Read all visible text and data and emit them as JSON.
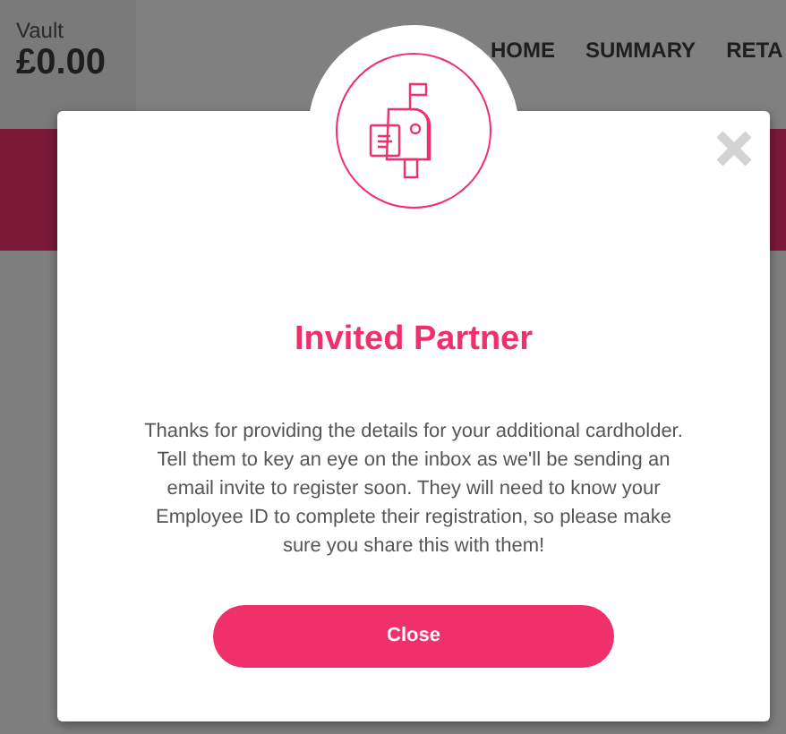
{
  "header": {
    "vault_label": "Vault",
    "vault_balance": "£0.00",
    "nav": [
      "HOME",
      "SUMMARY",
      "RETA"
    ]
  },
  "dialog": {
    "title": "Invited Partner",
    "message": "Thanks for providing the details for your additional cardholder.   Tell them to key an eye on the inbox as we'll be sending an email invite to register soon. They will need to know your Employee ID to complete their registration, so please make sure you share this with them!",
    "button": "Close"
  }
}
